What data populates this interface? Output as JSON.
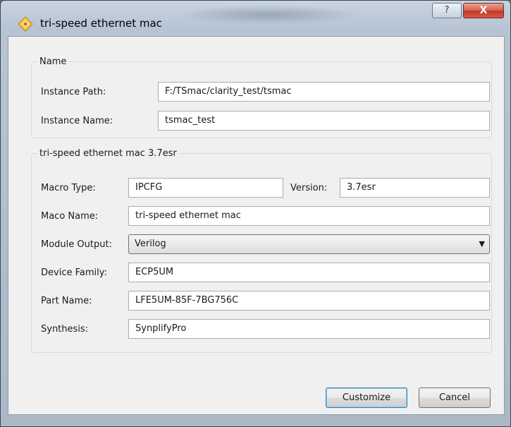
{
  "window": {
    "title": "tri-speed ethernet mac",
    "help_label": "?",
    "close_label": "X"
  },
  "name_group": {
    "legend": "Name",
    "instance_path_label": "Instance Path:",
    "instance_path_value": "F:/TSmac/clarity_test/tsmac",
    "instance_name_label": "Instance Name:",
    "instance_name_value": "tsmac_test"
  },
  "module_group": {
    "legend": "tri-speed ethernet mac 3.7esr",
    "macro_type_label": "Macro Type:",
    "macro_type_value": "IPCFG",
    "version_label": "Version:",
    "version_value": "3.7esr",
    "maco_name_label": "Maco Name:",
    "maco_name_value": "tri-speed ethernet mac",
    "module_output_label": "Module Output:",
    "module_output_value": "Verilog",
    "device_family_label": "Device Family:",
    "device_family_value": "ECP5UM",
    "part_name_label": "Part Name:",
    "part_name_value": "LFE5UM-85F-7BG756C",
    "synthesis_label": "Synthesis:",
    "synthesis_value": "SynplifyPro"
  },
  "buttons": {
    "customize": "Customize",
    "cancel": "Cancel"
  },
  "icons": {
    "app": "diamond-icon",
    "help": "help-icon",
    "close": "close-icon",
    "dropdown": "chevron-down-icon"
  }
}
